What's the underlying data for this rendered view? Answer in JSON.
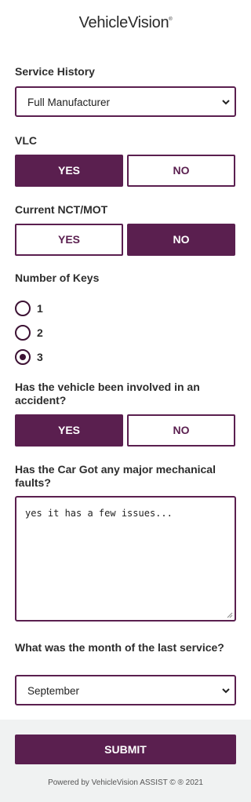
{
  "brand": {
    "name": "VehicleVision",
    "mark": "®"
  },
  "service_history": {
    "label": "Service History",
    "selected": "Full Manufacturer"
  },
  "vlc": {
    "label": "VLC",
    "yes": "YES",
    "no": "NO",
    "value": "YES"
  },
  "nct": {
    "label": "Current NCT/MOT",
    "yes": "YES",
    "no": "NO",
    "value": "NO"
  },
  "keys": {
    "label": "Number of Keys",
    "options": [
      "1",
      "2",
      "3"
    ],
    "selected": "3"
  },
  "accident": {
    "label": "Has the vehicle been involved in an accident?",
    "yes": "YES",
    "no": "NO",
    "value": "YES"
  },
  "faults": {
    "label": "Has the Car Got any major mechanical faults?",
    "value": "yes it has a few issues..."
  },
  "last_service": {
    "label": "What was the month of the last service?",
    "selected": "September"
  },
  "footer": {
    "submit": "SUBMIT",
    "powered_by": "Powered by VehicleVision ASSIST © ® 2021"
  },
  "colors": {
    "accent": "#5a1f4f",
    "footer_bg": "#f0f2f2"
  }
}
